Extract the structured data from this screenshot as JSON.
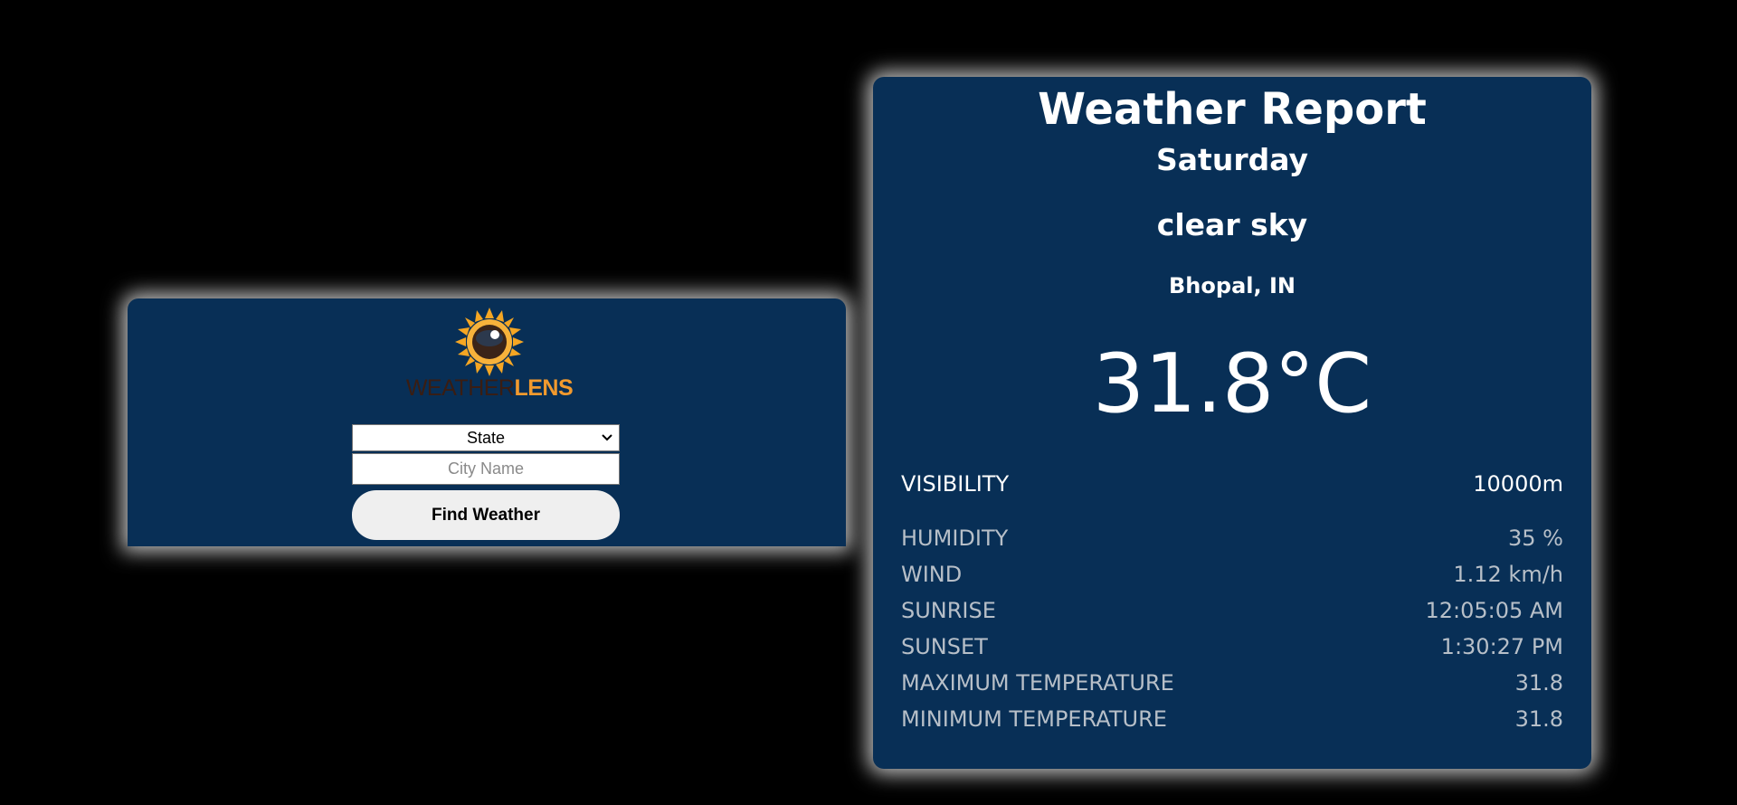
{
  "search": {
    "logo_word_1": "WEATHER",
    "logo_word_2": "LENS",
    "state_select_value": "State",
    "city_placeholder": "City Name",
    "find_button_label": "Find Weather"
  },
  "report": {
    "title": "Weather Report",
    "day": "Saturday",
    "description": "clear sky",
    "location": "Bhopal, IN",
    "temperature": "31.8°C",
    "rows": [
      {
        "label": "VISIBILITY",
        "value": "10000m"
      },
      {
        "label": "HUMIDITY",
        "value": "35 %"
      },
      {
        "label": "WIND",
        "value": "1.12 km/h"
      },
      {
        "label": "SUNRISE",
        "value": "12:05:05 AM"
      },
      {
        "label": "SUNSET",
        "value": "1:30:27 PM"
      },
      {
        "label": "MAXIMUM TEMPERATURE",
        "value": "31.8"
      },
      {
        "label": "MINIMUM TEMPERATURE",
        "value": "31.8"
      }
    ]
  },
  "colors": {
    "background": "#000000",
    "card": "#082f56",
    "logo_dark": "#3a1d12",
    "logo_accent": "#f29a2e",
    "secondary_text": "#b7bfc8"
  },
  "icons": {
    "logo": "sun-eye-logo-icon",
    "select_caret": "chevron-down-icon"
  }
}
